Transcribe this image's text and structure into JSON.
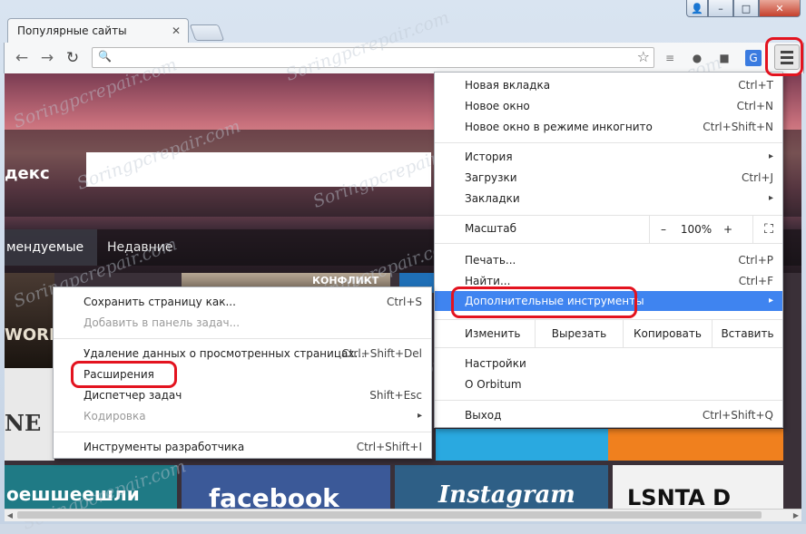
{
  "window": {
    "tab_title": "Популярные сайты",
    "tab_close": "✕",
    "controls": {
      "user": "👤",
      "minimize": "–",
      "maximize": "□",
      "close": "✕"
    }
  },
  "toolbar": {
    "back": "←",
    "forward": "→",
    "reload": "↻",
    "address_value": "",
    "search_glyph": "🔍",
    "star_glyph": "☆",
    "ext_icons": [
      "≡",
      "●",
      "■",
      "G"
    ]
  },
  "page": {
    "search_label": "декс",
    "nav_recommended": "мендуемые",
    "nav_recent": "Недавние",
    "tiles": {
      "wot": "WORL",
      "konflikt": "КОНФЛИКТ",
      "ne": "NE",
      "bottom1": "оешшеешли",
      "facebook": "facebook",
      "instagram": "Instagram",
      "last": "LSNTA D"
    }
  },
  "watermark": "Soringpcrepair.com",
  "chrome_menu": {
    "items": [
      {
        "label": "Новая вкладка",
        "shortcut": "Ctrl+T"
      },
      {
        "label": "Новое окно",
        "shortcut": "Ctrl+N"
      },
      {
        "label": "Новое окно в режиме инкогнито",
        "shortcut": "Ctrl+Shift+N"
      },
      {
        "label": "История",
        "arrow": "▸"
      },
      {
        "label": "Загрузки",
        "shortcut": "Ctrl+J"
      },
      {
        "label": "Закладки",
        "arrow": "▸"
      }
    ],
    "zoom": {
      "label": "Масштаб",
      "minus": "–",
      "value": "100%",
      "plus": "+",
      "fullscreen": "⛶"
    },
    "print": {
      "label": "Печать...",
      "shortcut": "Ctrl+P"
    },
    "find": {
      "label": "Найти...",
      "shortcut": "Ctrl+F"
    },
    "more_tools": {
      "label": "Дополнительные инструменты",
      "arrow": "▸"
    },
    "edit": {
      "label": "Изменить",
      "cut": "Вырезать",
      "copy": "Копировать",
      "paste": "Вставить"
    },
    "settings": "Настройки",
    "about": "О Orbitum",
    "exit": {
      "label": "Выход",
      "shortcut": "Ctrl+Shift+Q"
    }
  },
  "submenu": {
    "items": [
      {
        "label": "Сохранить страницу как...",
        "shortcut": "Ctrl+S",
        "disabled": false
      },
      {
        "label": "Добавить в панель задач...",
        "shortcut": "",
        "disabled": true
      },
      {
        "label": "Удаление данных о просмотренных страницах...",
        "shortcut": "Ctrl+Shift+Del",
        "disabled": false
      },
      {
        "label": "Расширения",
        "shortcut": "",
        "disabled": false
      },
      {
        "label": "Диспетчер задач",
        "shortcut": "Shift+Esc",
        "disabled": false
      },
      {
        "label": "Кодировка",
        "shortcut": "",
        "disabled": true,
        "arrow": "▸"
      },
      {
        "label": "Инструменты разработчика",
        "shortcut": "Ctrl+Shift+I",
        "disabled": false
      }
    ]
  },
  "colors": {
    "highlight": "#3f84f0",
    "annotation": "#e3131f"
  }
}
